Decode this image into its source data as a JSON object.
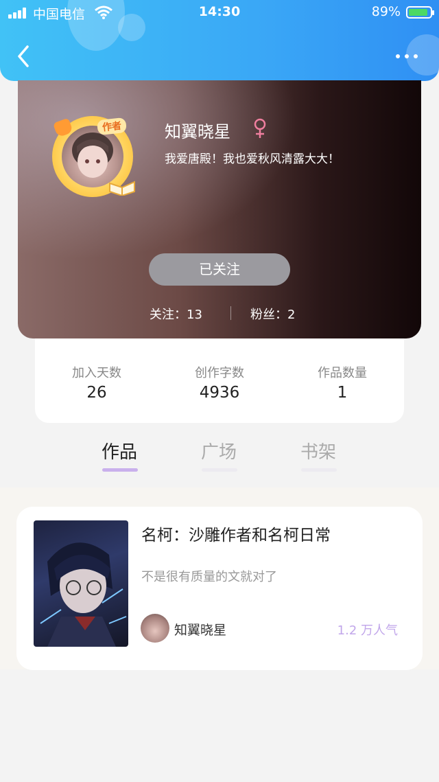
{
  "status_bar": {
    "carrier": "中国电信",
    "time": "14:30",
    "battery_percent": "89%",
    "battery_level": 0.89
  },
  "header": {
    "back_icon": "chevron-left-icon",
    "more_icon": "more-horizontal-icon",
    "accent_color": "#3aa7f6"
  },
  "profile": {
    "author_badge": "作者",
    "name": "知翼晓星",
    "gender_symbol": "♀",
    "bio": "我爱唐殿！我也爱秋风清露大大！",
    "follow_button": "已关注",
    "following_label": "关注：13",
    "fans_label": "粉丝：2"
  },
  "stats": [
    {
      "label": "加入天数",
      "value": "26"
    },
    {
      "label": "创作字数",
      "value": "4936"
    },
    {
      "label": "作品数量",
      "value": "1"
    }
  ],
  "tabs": [
    {
      "label": "作品",
      "active": true
    },
    {
      "label": "广场",
      "active": false
    },
    {
      "label": "书架",
      "active": false
    }
  ],
  "works": [
    {
      "title": "名柯：沙雕作者和名柯日常",
      "description": "不是很有质量的文就对了",
      "author": "知翼晓星",
      "popularity": "1.2 万人气"
    }
  ]
}
